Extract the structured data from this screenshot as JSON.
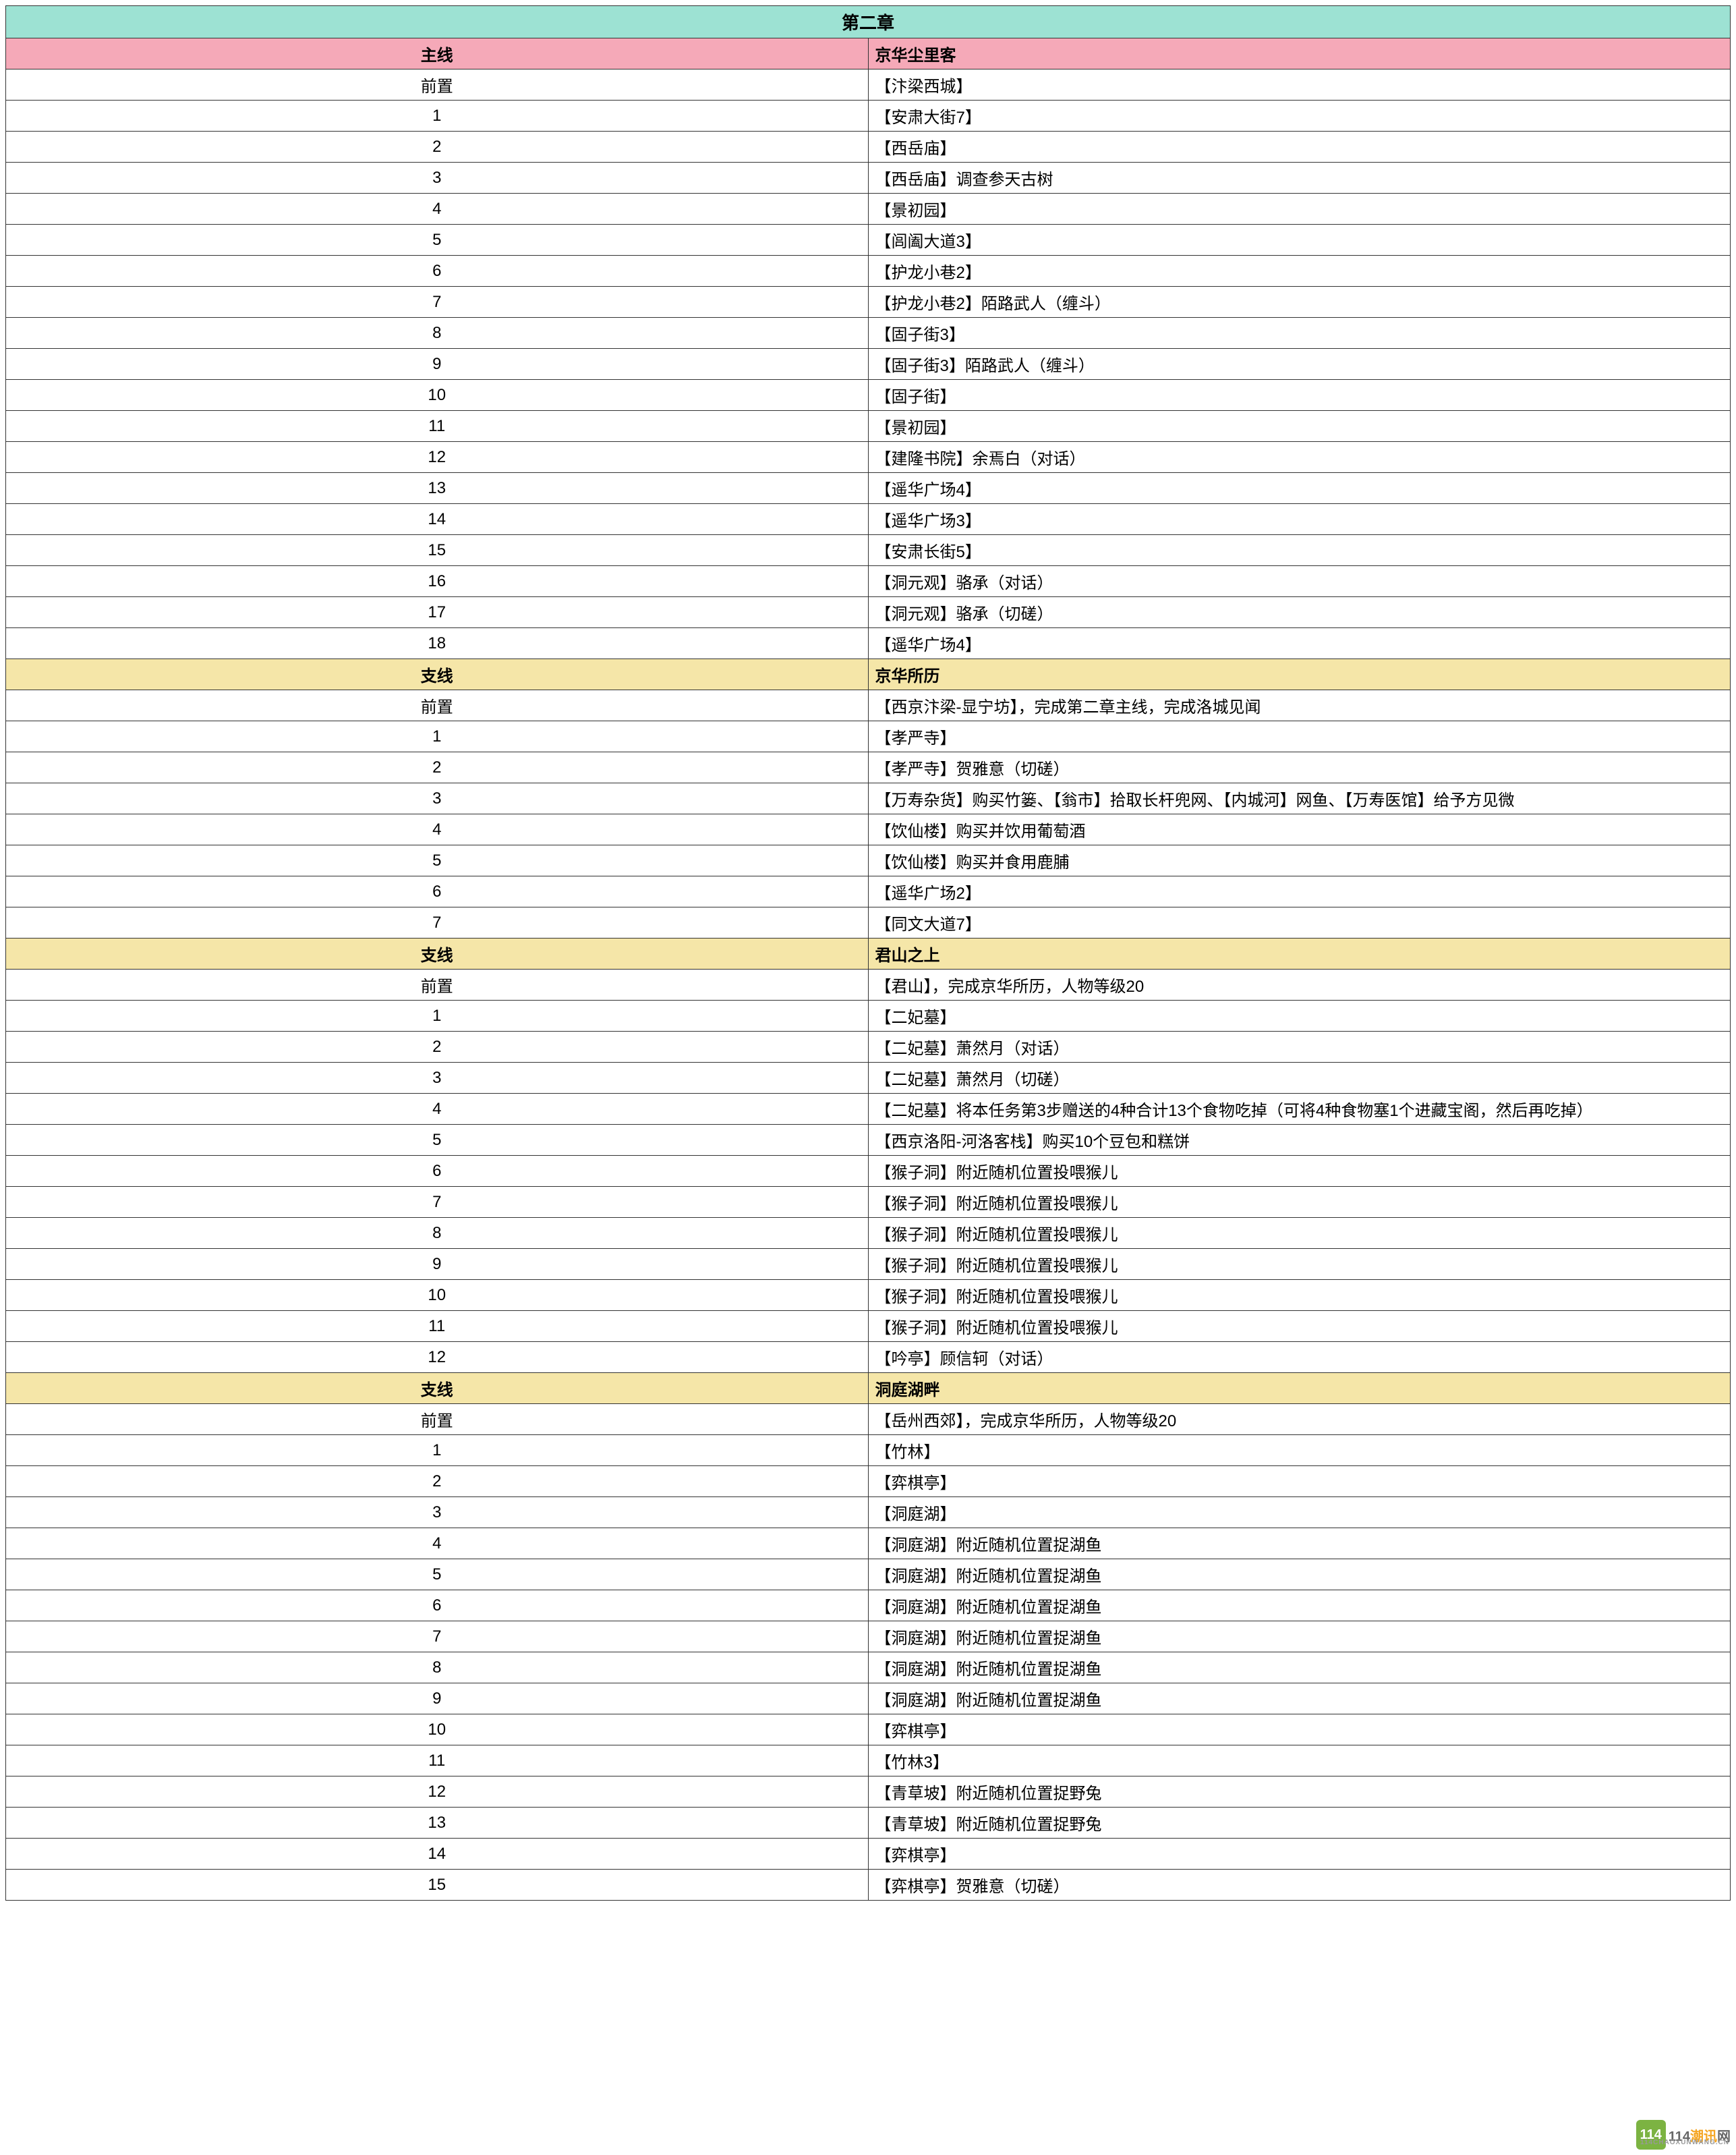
{
  "chapter_title": "第二章",
  "sections": [
    {
      "type": "main",
      "label_left": "主线",
      "label_right": "京华尘里客",
      "rows": [
        {
          "num": "前置",
          "content": "【汴梁西城】"
        },
        {
          "num": "1",
          "content": "【安肃大街7】"
        },
        {
          "num": "2",
          "content": "【西岳庙】"
        },
        {
          "num": "3",
          "content": "【西岳庙】调查参天古树"
        },
        {
          "num": "4",
          "content": "【景初园】"
        },
        {
          "num": "5",
          "content": "【闾阖大道3】"
        },
        {
          "num": "6",
          "content": "【护龙小巷2】"
        },
        {
          "num": "7",
          "content": "【护龙小巷2】陌路武人（缠斗）"
        },
        {
          "num": "8",
          "content": "【固子街3】"
        },
        {
          "num": "9",
          "content": "【固子街3】陌路武人（缠斗）"
        },
        {
          "num": "10",
          "content": "【固子街】"
        },
        {
          "num": "11",
          "content": "【景初园】"
        },
        {
          "num": "12",
          "content": "【建隆书院】余焉白（对话）"
        },
        {
          "num": "13",
          "content": "【遥华广场4】"
        },
        {
          "num": "14",
          "content": "【遥华广场3】"
        },
        {
          "num": "15",
          "content": "【安肃长街5】"
        },
        {
          "num": "16",
          "content": "【洞元观】骆承（对话）"
        },
        {
          "num": "17",
          "content": "【洞元观】骆承（切磋）"
        },
        {
          "num": "18",
          "content": "【遥华广场4】"
        }
      ]
    },
    {
      "type": "sub",
      "label_left": "支线",
      "label_right": "京华所历",
      "rows": [
        {
          "num": "前置",
          "content": "【西京汴梁-显宁坊】，完成第二章主线，完成洛城见闻"
        },
        {
          "num": "1",
          "content": "【孝严寺】"
        },
        {
          "num": "2",
          "content": "【孝严寺】贺雅意（切磋）"
        },
        {
          "num": "3",
          "content": "【万寿杂货】购买竹篓、【翁市】拾取长杆兜网、【内城河】网鱼、【万寿医馆】给予方见微"
        },
        {
          "num": "4",
          "content": "【饮仙楼】购买并饮用葡萄酒"
        },
        {
          "num": "5",
          "content": "【饮仙楼】购买并食用鹿脯"
        },
        {
          "num": "6",
          "content": "【遥华广场2】"
        },
        {
          "num": "7",
          "content": "【同文大道7】"
        }
      ]
    },
    {
      "type": "sub",
      "label_left": "支线",
      "label_right": "君山之上",
      "rows": [
        {
          "num": "前置",
          "content": "【君山】，完成京华所历，人物等级20"
        },
        {
          "num": "1",
          "content": "【二妃墓】"
        },
        {
          "num": "2",
          "content": "【二妃墓】萧然月（对话）"
        },
        {
          "num": "3",
          "content": "【二妃墓】萧然月（切磋）"
        },
        {
          "num": "4",
          "content": "【二妃墓】将本任务第3步赠送的4种合计13个食物吃掉（可将4种食物塞1个进藏宝阁，然后再吃掉）"
        },
        {
          "num": "5",
          "content": "【西京洛阳-河洛客栈】购买10个豆包和糕饼"
        },
        {
          "num": "6",
          "content": "【猴子洞】附近随机位置投喂猴儿"
        },
        {
          "num": "7",
          "content": "【猴子洞】附近随机位置投喂猴儿"
        },
        {
          "num": "8",
          "content": "【猴子洞】附近随机位置投喂猴儿"
        },
        {
          "num": "9",
          "content": "【猴子洞】附近随机位置投喂猴儿"
        },
        {
          "num": "10",
          "content": "【猴子洞】附近随机位置投喂猴儿"
        },
        {
          "num": "11",
          "content": "【猴子洞】附近随机位置投喂猴儿"
        },
        {
          "num": "12",
          "content": "【吟亭】顾信轲（对话）"
        }
      ]
    },
    {
      "type": "sub",
      "label_left": "支线",
      "label_right": "洞庭湖畔",
      "rows": [
        {
          "num": "前置",
          "content": "【岳州西郊】，完成京华所历，人物等级20"
        },
        {
          "num": "1",
          "content": "【竹林】"
        },
        {
          "num": "2",
          "content": "【弈棋亭】"
        },
        {
          "num": "3",
          "content": "【洞庭湖】"
        },
        {
          "num": "4",
          "content": "【洞庭湖】附近随机位置捉湖鱼"
        },
        {
          "num": "5",
          "content": "【洞庭湖】附近随机位置捉湖鱼"
        },
        {
          "num": "6",
          "content": "【洞庭湖】附近随机位置捉湖鱼"
        },
        {
          "num": "7",
          "content": "【洞庭湖】附近随机位置捉湖鱼"
        },
        {
          "num": "8",
          "content": "【洞庭湖】附近随机位置捉湖鱼"
        },
        {
          "num": "9",
          "content": "【洞庭湖】附近随机位置捉湖鱼"
        },
        {
          "num": "10",
          "content": "【弈棋亭】"
        },
        {
          "num": "11",
          "content": "【竹林3】"
        },
        {
          "num": "12",
          "content": "【青草坡】附近随机位置捉野兔"
        },
        {
          "num": "13",
          "content": "【青草坡】附近随机位置捉野兔"
        },
        {
          "num": "14",
          "content": "【弈棋亭】"
        },
        {
          "num": "15",
          "content": "【弈棋亭】贺雅意（切磋）"
        }
      ]
    }
  ],
  "footer": {
    "logo_text": "114",
    "brand_main": "114",
    "brand_accent": "潮讯",
    "brand_suffix": "网",
    "brand_sub": "114CHAOXUNWANG.CN"
  }
}
